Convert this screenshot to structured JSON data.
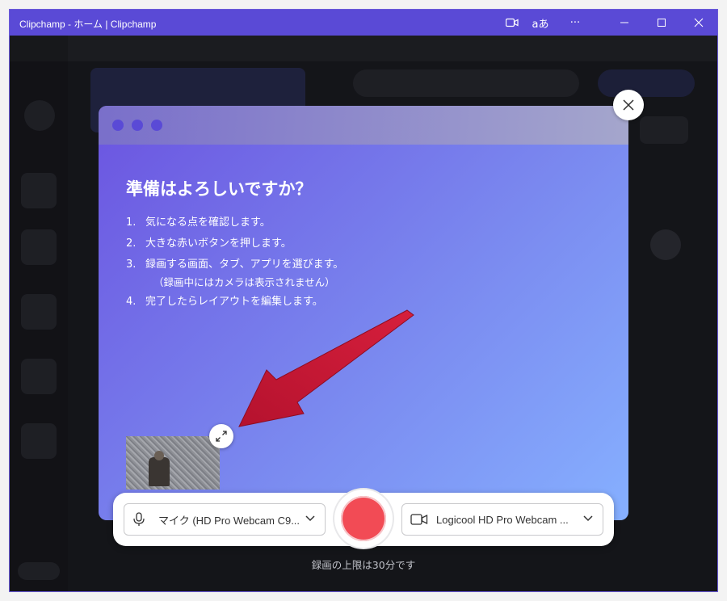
{
  "window": {
    "title": "Clipchamp - ホーム | Clipchamp",
    "translate_label": "aあ",
    "more_label": "···",
    "accent": "#5a4ad6"
  },
  "modal": {
    "title": "準備はよろしいですか？",
    "steps": [
      {
        "num": "1.",
        "text": "気になる点を確認します。"
      },
      {
        "num": "2.",
        "text": "大きな赤いボタンを押します。"
      },
      {
        "num": "3.",
        "text": "録画する画面、タブ、アプリを選びます。"
      },
      {
        "num": "4.",
        "text": "完了したらレイアウトを編集します。"
      }
    ],
    "step3_note": "（録画中にはカメラは表示されません）"
  },
  "controls": {
    "mic_label": "マイク (HD Pro Webcam C9...",
    "camera_label": "Logicool HD Pro Webcam ...",
    "record_color": "#f24b55",
    "limit_text": "録画の上限は30分です"
  },
  "icons": {
    "close": "close-icon",
    "expand": "expand-icon",
    "mic": "microphone-icon",
    "camera": "video-camera-icon",
    "chevron": "chevron-down-icon"
  }
}
